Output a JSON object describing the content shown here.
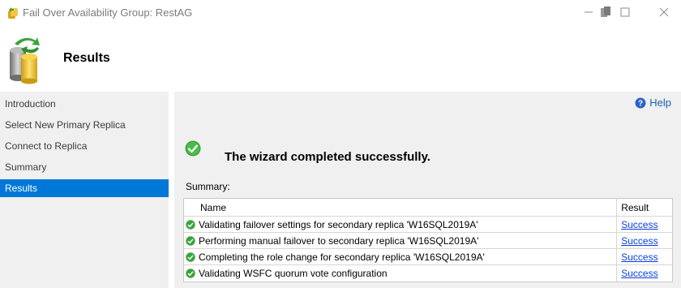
{
  "window": {
    "title": "Fail Over Availability Group: RestAG"
  },
  "header": {
    "title": "Results",
    "icon": "database-failover-icon"
  },
  "sidebar": {
    "items": [
      {
        "label": "Introduction",
        "selected": false
      },
      {
        "label": "Select New Primary Replica",
        "selected": false
      },
      {
        "label": "Connect to Replica",
        "selected": false
      },
      {
        "label": "Summary",
        "selected": false
      },
      {
        "label": "Results",
        "selected": true
      }
    ]
  },
  "main": {
    "help_label": "Help",
    "success_message": "The wizard completed successfully.",
    "summary_label": "Summary:",
    "table": {
      "columns": [
        "Name",
        "Result"
      ],
      "rows": [
        {
          "name": "Validating failover settings for secondary replica 'W16SQL2019A'",
          "result": "Success"
        },
        {
          "name": "Performing manual failover to secondary replica 'W16SQL2019A'",
          "result": "Success"
        },
        {
          "name": "Completing the role change for secondary replica 'W16SQL2019A'",
          "result": "Success"
        },
        {
          "name": "Validating WSFC quorum vote configuration",
          "result": "Success"
        }
      ]
    }
  },
  "colors": {
    "accent": "#0078d7",
    "success_green": "#3aa43a",
    "link": "#0a3de0",
    "panel_bg": "#f0f0f0"
  }
}
